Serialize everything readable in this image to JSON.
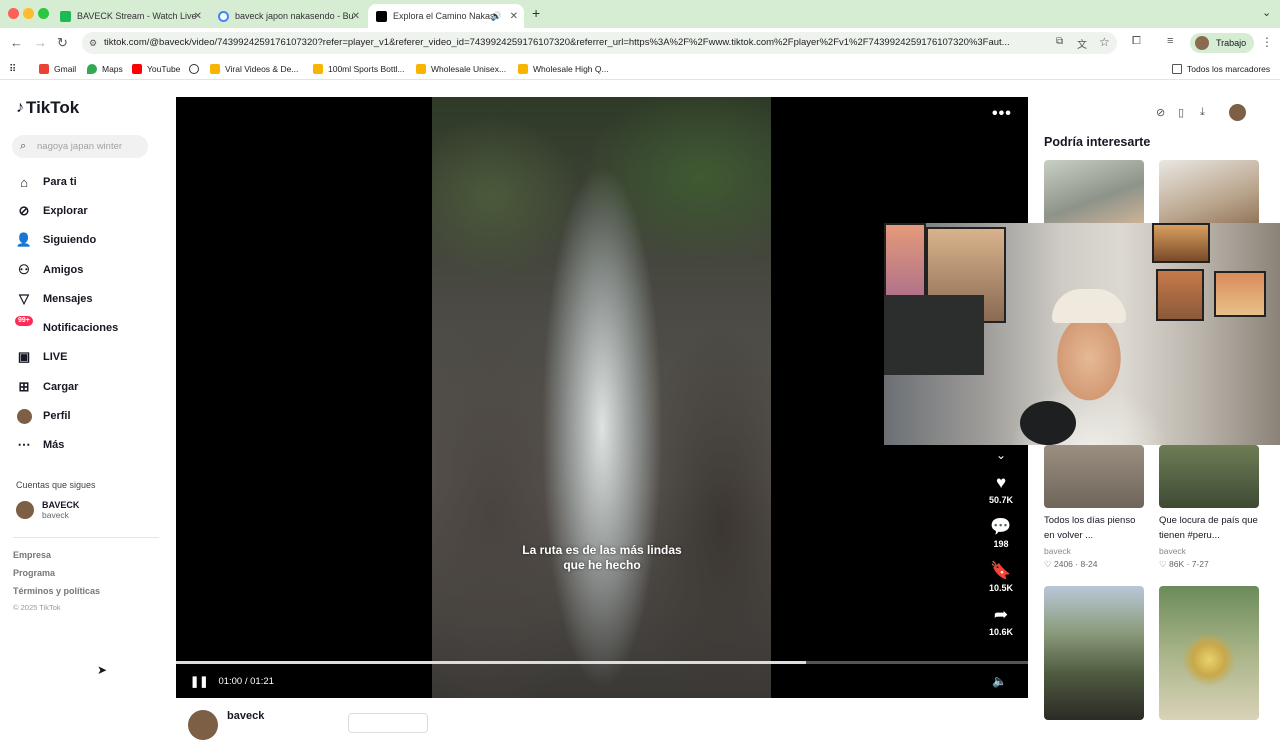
{
  "browser": {
    "tabs": [
      {
        "label": "BAVECK Stream - Watch Live",
        "fav_color": "#1db954"
      },
      {
        "label": "baveck japon nakasendo - Bu",
        "fav_color": "#4285f4"
      },
      {
        "label": "Explora el Camino Nakase",
        "fav_color": "#000000",
        "active": true
      }
    ],
    "url": "tiktok.com/@baveck/video/7439924259176107320?refer=player_v1&referer_video_id=7439924259176107320&referrer_url=https%3A%2F%2Fwww.tiktok.com%2Fplayer%2Fv1%2F7439924259176107320%3Faut...",
    "profile_label": "Trabajo",
    "bookmarks": [
      "Gmail",
      "Maps",
      "YouTube",
      "",
      "Viral Videos & De...",
      "100ml Sports Bottl...",
      "Wholesale Unisex...",
      "Wholesale High Q..."
    ],
    "all_bookmarks": "Todos los marcadores"
  },
  "sidebar": {
    "logo": "TikTok",
    "search_placeholder": "nagoya japan winter",
    "nav": [
      "Para ti",
      "Explorar",
      "Siguiendo",
      "Amigos",
      "Mensajes",
      "Notificaciones",
      "LIVE",
      "Cargar",
      "Perfil",
      "Más"
    ],
    "notif_badge": "99+",
    "following_title": "Cuentas que sigues",
    "following": {
      "name": "BAVECK",
      "handle": "baveck"
    },
    "footer": [
      "Empresa",
      "Programa",
      "Términos y políticas"
    ],
    "copyright": "© 2025 TikTok"
  },
  "video": {
    "caption_line1": "La ruta es de las más lindas",
    "caption_line2": "que he hecho",
    "likes": "50.7K",
    "comments": "198",
    "saves": "10.5K",
    "shares": "10.6K",
    "time": "01:00 / 01:21",
    "progress": 0.74,
    "author": "baveck"
  },
  "right_panel": {
    "title": "Podría interesarte",
    "videos": [
      {
        "title": "Todos los días pienso en volver ...",
        "author": "baveck",
        "likes": "2406",
        "date": "8-24"
      },
      {
        "title": "Que locura de país que tienen #peru...",
        "author": "baveck",
        "likes": "86K",
        "date": "7-27"
      }
    ]
  },
  "colors": {
    "accent": "#fe2c55",
    "tabbar": "#d6ecd3"
  }
}
